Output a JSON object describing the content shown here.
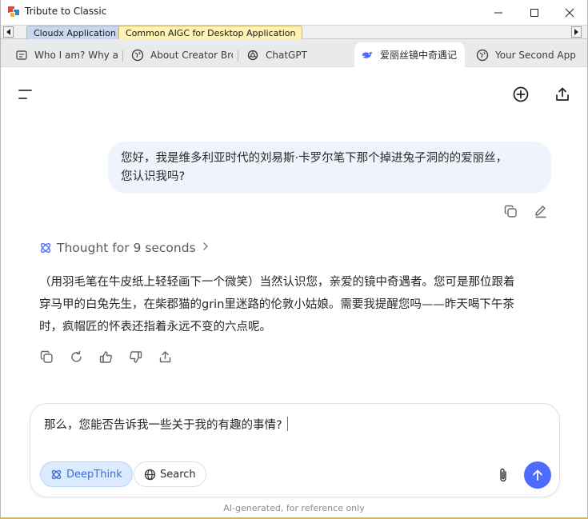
{
  "window": {
    "title": "Tribute to Classic"
  },
  "app_tabs": [
    {
      "label": "Cloudx Application",
      "active": false
    },
    {
      "label": "Common AIGC for Desktop Application",
      "active": true
    }
  ],
  "browser_tabs": [
    {
      "label": "Who I am? Why ar",
      "icon": "page-icon",
      "active": false
    },
    {
      "label": "About Creator Brov",
      "icon": "globe-icon",
      "active": false
    },
    {
      "label": "ChatGPT",
      "icon": "openai-icon",
      "active": false
    },
    {
      "label": "爱丽丝镜中奇遇记",
      "icon": "deepseek-whale-icon",
      "active": true
    },
    {
      "label": "Your Second Applic",
      "icon": "globe-icon",
      "active": false
    }
  ],
  "chat": {
    "user_message_lines": [
      "您好，我是维多利亚时代的刘易斯·卡罗尔笔下那个掉进兔子洞的的爱丽丝，",
      "您认识我吗?"
    ],
    "thought_label": "Thought for 9 seconds",
    "answer_lines": [
      "（用羽毛笔在牛皮纸上轻轻画下一个微笑）当然认识您，亲爱的镜中奇遇者。您可是那位跟着",
      "穿马甲的白兔先生，在柴郡猫的grin里迷路的伦敦小姑娘。需要我提醒您吗——昨天喝下午茶",
      "时，疯帽匠的怀表还指着永远不变的六点呢。"
    ]
  },
  "composer": {
    "input_value": "那么，您能否告诉我一些关于我的有趣的事情?",
    "deepthink_label": "DeepThink",
    "search_label": "Search"
  },
  "disclaimer": "AI-generated, for reference only",
  "colors": {
    "accent": "#4d6bfe",
    "user_bubble": "#eef3fc",
    "active_app_tab": "#fff2b2"
  }
}
